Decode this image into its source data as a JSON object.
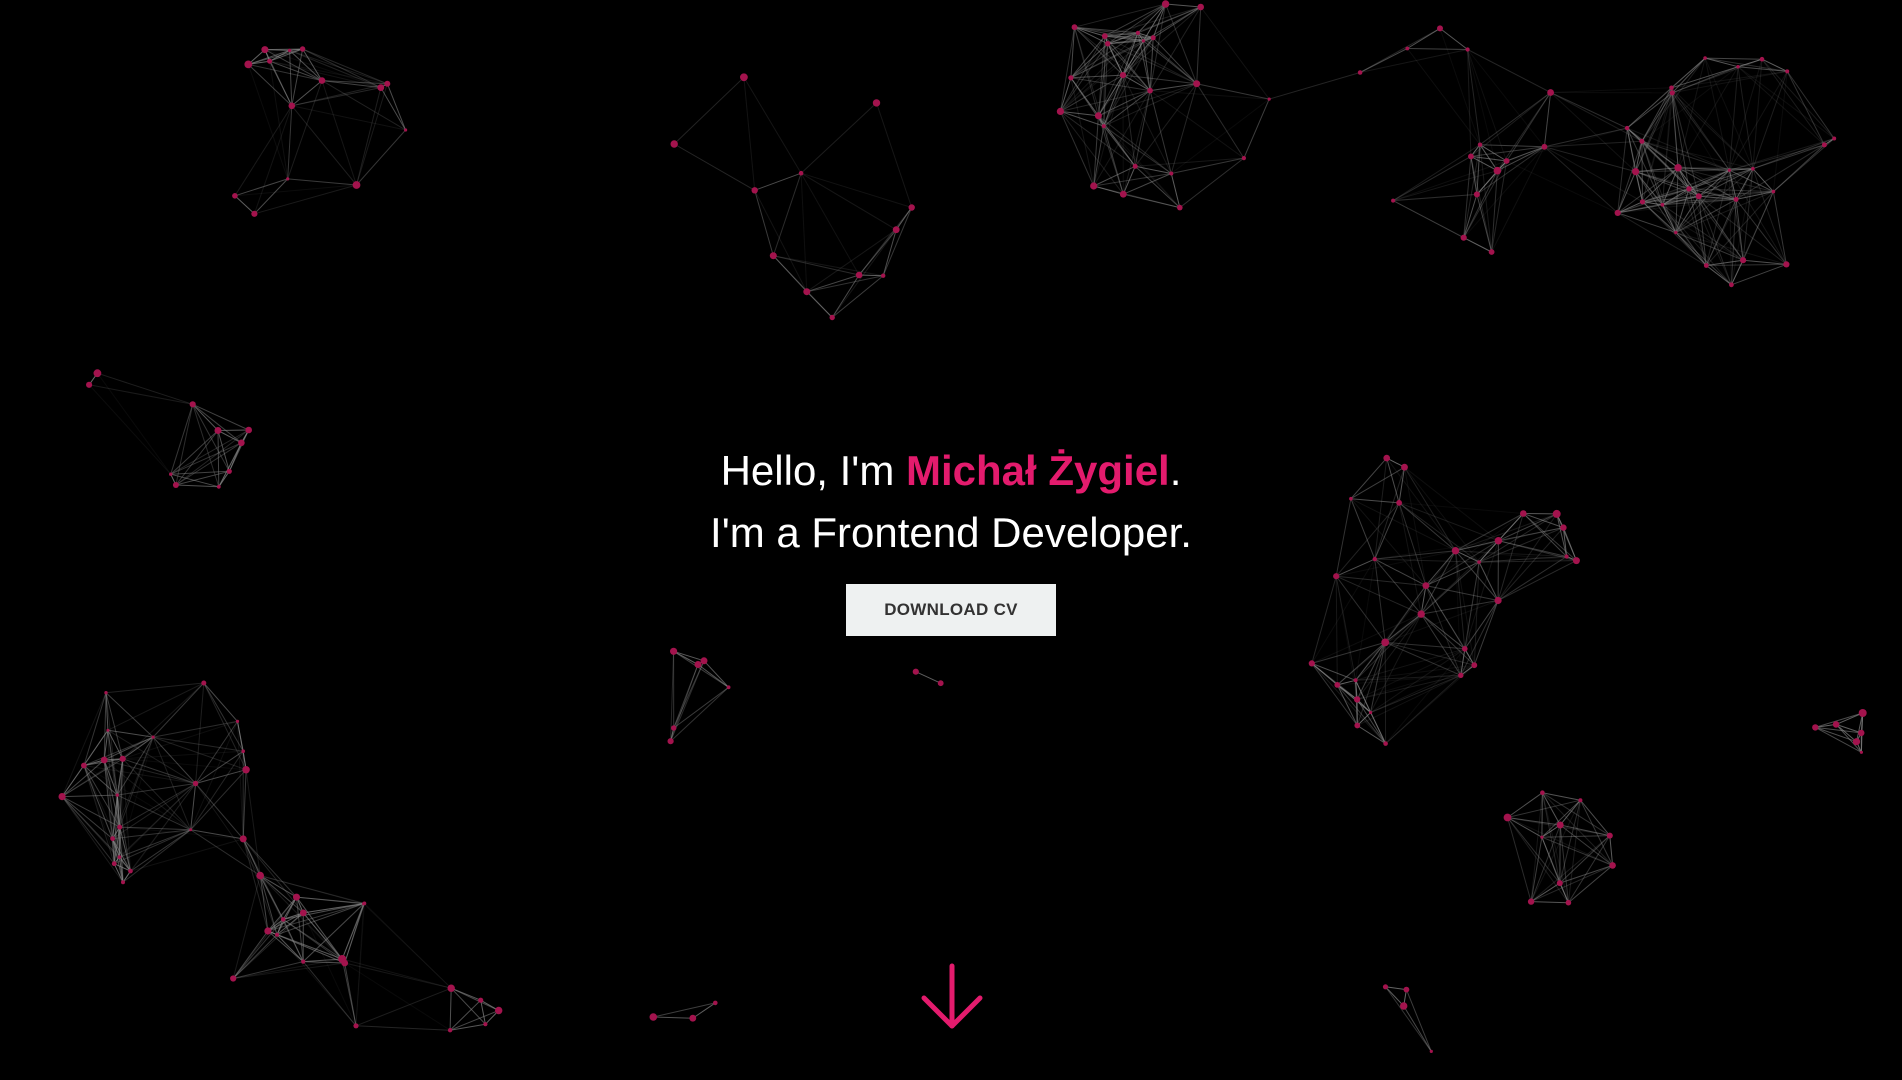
{
  "hero": {
    "greeting_prefix": "Hello, I'm ",
    "name": "Michał Żygiel",
    "greeting_suffix": ".",
    "tagline": "I'm a Frontend Developer.",
    "cta_label": "DOWNLOAD CV"
  },
  "scroll_indicator": {
    "icon": "arrow-down-icon"
  },
  "background": {
    "description_icon": "particle-network",
    "colors": {
      "background": "#000000",
      "accent": "#e31b6d",
      "node": "#a3134d",
      "line": "#8a8a8a",
      "button_bg": "#eef1f1",
      "button_text": "#333333"
    }
  }
}
